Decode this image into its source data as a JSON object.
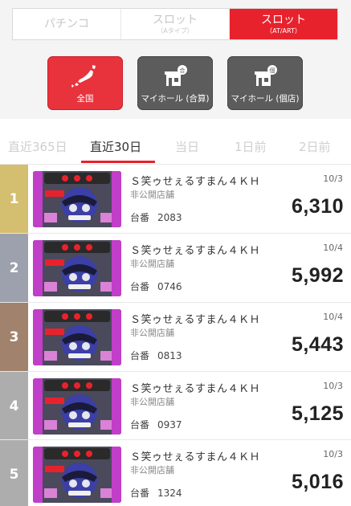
{
  "machine_tabs": [
    {
      "main": "パチンコ",
      "sub": ""
    },
    {
      "main": "スロット",
      "sub": "（Aタイプ）"
    },
    {
      "main": "スロット",
      "sub": "（AT/ART）"
    }
  ],
  "category_buttons": [
    {
      "label": "全国",
      "icon": "japan-map-icon"
    },
    {
      "label": "マイホール (合算)",
      "icon": "hall-total-icon"
    },
    {
      "label": "マイホール (個店)",
      "icon": "hall-single-icon"
    }
  ],
  "period_tabs": [
    "直近365日",
    "直近30日",
    "当日",
    "1日前",
    "2日前"
  ],
  "colors": {
    "accent": "#e8222d",
    "rank1": "#d4be6f",
    "rank2": "#9da1ad",
    "rank3": "#a1826c",
    "rank_other": "#adadad"
  },
  "rankings": [
    {
      "rank": "1",
      "machine": "Ｓ笑ゥせぇるすまん４ＫＨ",
      "store": "非公開店舗",
      "tai_label": "台番",
      "tai": "2083",
      "date": "10/3",
      "value": "6,310"
    },
    {
      "rank": "2",
      "machine": "Ｓ笑ゥせぇるすまん４ＫＨ",
      "store": "非公開店舗",
      "tai_label": "台番",
      "tai": "0746",
      "date": "10/4",
      "value": "5,992"
    },
    {
      "rank": "3",
      "machine": "Ｓ笑ゥせぇるすまん４ＫＨ",
      "store": "非公開店舗",
      "tai_label": "台番",
      "tai": "0813",
      "date": "10/4",
      "value": "5,443"
    },
    {
      "rank": "4",
      "machine": "Ｓ笑ゥせぇるすまん４ＫＨ",
      "store": "非公開店舗",
      "tai_label": "台番",
      "tai": "0937",
      "date": "10/3",
      "value": "5,125"
    },
    {
      "rank": "5",
      "machine": "Ｓ笑ゥせぇるすまん４ＫＨ",
      "store": "非公開店舗",
      "tai_label": "台番",
      "tai": "1324",
      "date": "10/3",
      "value": "5,016"
    }
  ]
}
